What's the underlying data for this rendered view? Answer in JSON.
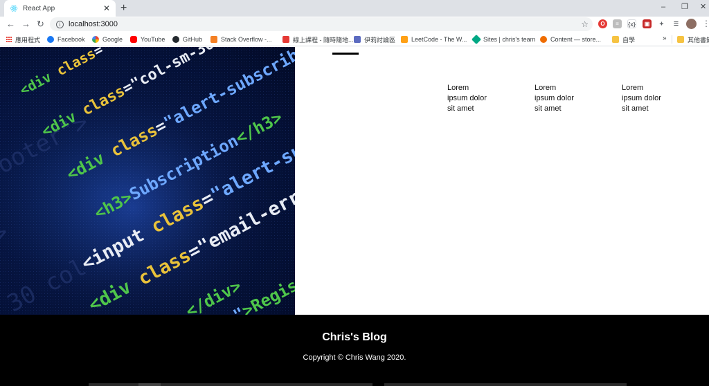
{
  "browser": {
    "tab": {
      "title": "React App"
    },
    "window_controls": {
      "minimize": "–",
      "restore": "❐",
      "close": "✕"
    },
    "new_tab": "+",
    "address": {
      "url": "localhost:3000"
    },
    "bookmarks": [
      {
        "label": "應用程式",
        "icon": "apps-grid-icon",
        "color": "#e8453c"
      },
      {
        "label": "Facebook",
        "icon": "facebook-icon",
        "color": "#1877f2"
      },
      {
        "label": "Google",
        "icon": "google-icon",
        "color": "#4285f4"
      },
      {
        "label": "YouTube",
        "icon": "youtube-icon",
        "color": "#ff0000"
      },
      {
        "label": "GitHub",
        "icon": "github-icon",
        "color": "#24292e"
      },
      {
        "label": "Stack Overflow -...",
        "icon": "stackoverflow-icon",
        "color": "#f48024"
      },
      {
        "label": "線上課程 - 隨時隨地...",
        "icon": "course-icon",
        "color": "#e53935"
      },
      {
        "label": "伊莉討論區",
        "icon": "forum-icon",
        "color": "#5c6bc0"
      },
      {
        "label": "LeetCode - The W...",
        "icon": "leetcode-icon",
        "color": "#ffa116"
      },
      {
        "label": "Sites | chris's team",
        "icon": "sites-icon",
        "color": "#00a884"
      },
      {
        "label": "Content — store...",
        "icon": "content-icon",
        "color": "#ef6c00"
      },
      {
        "label": "自學",
        "icon": "folder-icon",
        "color": "#f6c342"
      },
      {
        "label": "其他書籤",
        "icon": "folder-icon",
        "color": "#f6c342"
      }
    ],
    "bookmarks_more": "»"
  },
  "page": {
    "features": [
      {
        "text": "Lorem\nipsum dolor\nsit amet"
      },
      {
        "text": "Lorem\nipsum dolor\nsit amet"
      },
      {
        "text": "Lorem\nipsum dolor\nsit amet"
      }
    ],
    "footer": {
      "title": "Chris's Blog",
      "copyright": "Copyright © Chris Wang 2020."
    }
  }
}
